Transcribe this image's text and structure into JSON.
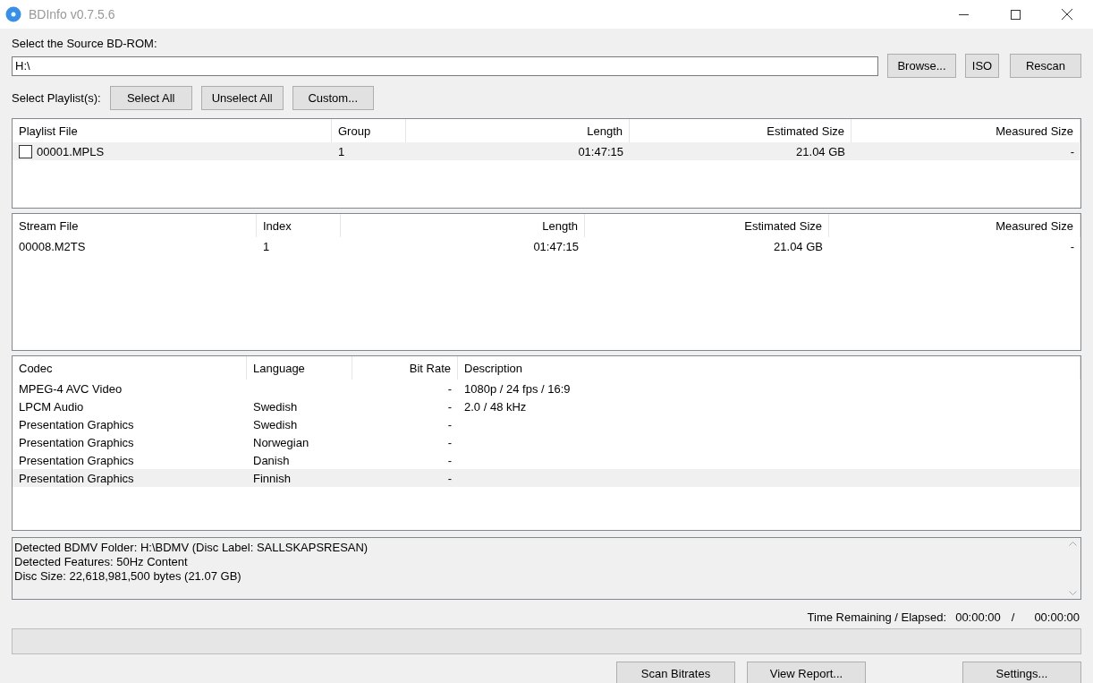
{
  "window": {
    "title": "BDInfo v0.7.5.6"
  },
  "source": {
    "label": "Select the Source BD-ROM:",
    "value": "H:\\",
    "buttons": [
      "Browse...",
      "ISO",
      "Rescan"
    ]
  },
  "playlist_select": {
    "label": "Select Playlist(s):",
    "buttons": [
      "Select All",
      "Unselect All",
      "Custom..."
    ]
  },
  "playlists": {
    "columns": [
      "Playlist File",
      "Group",
      "Length",
      "Estimated Size",
      "Measured Size"
    ],
    "rows": [
      {
        "cells": [
          "00001.MPLS",
          "1",
          "01:47:15",
          "21.04 GB",
          "-"
        ],
        "checked": false,
        "selected": true
      }
    ]
  },
  "streams": {
    "columns": [
      "Stream File",
      "Index",
      "Length",
      "Estimated Size",
      "Measured Size"
    ],
    "rows": [
      {
        "cells": [
          "00008.M2TS",
          "1",
          "01:47:15",
          "21.04 GB",
          "-"
        ],
        "selected": false
      }
    ]
  },
  "codecs": {
    "columns": [
      "Codec",
      "Language",
      "Bit Rate",
      "Description"
    ],
    "rows": [
      {
        "cells": [
          "MPEG-4 AVC Video",
          "",
          "-",
          "1080p / 24 fps / 16:9"
        ],
        "selected": false
      },
      {
        "cells": [
          "LPCM Audio",
          "Swedish",
          "-",
          "2.0 / 48 kHz"
        ],
        "selected": false
      },
      {
        "cells": [
          "Presentation Graphics",
          "Swedish",
          "-",
          ""
        ],
        "selected": false
      },
      {
        "cells": [
          "Presentation Graphics",
          "Norwegian",
          "-",
          ""
        ],
        "selected": false
      },
      {
        "cells": [
          "Presentation Graphics",
          "Danish",
          "-",
          ""
        ],
        "selected": false
      },
      {
        "cells": [
          "Presentation Graphics",
          "Finnish",
          "-",
          ""
        ],
        "selected": true
      }
    ]
  },
  "log": [
    "Detected BDMV Folder: H:\\BDMV (Disc Label: SALLSKAPSRESAN)",
    "Detected Features: 50Hz Content",
    "Disc Size: 22,618,981,500 bytes (21.07 GB)"
  ],
  "time": {
    "label": "Time Remaining / Elapsed:",
    "remaining": "00:00:00",
    "separator": "/",
    "elapsed": "00:00:00"
  },
  "progress": {
    "level": 0
  },
  "bottom_buttons": [
    "Scan Bitrates",
    "View Report...",
    "Settings..."
  ]
}
